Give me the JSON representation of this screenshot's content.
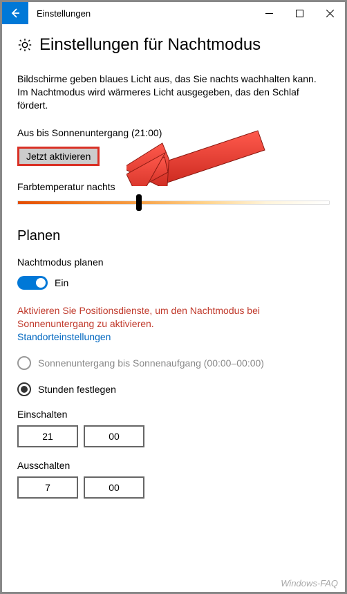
{
  "window": {
    "app_title": "Einstellungen"
  },
  "page": {
    "title": "Einstellungen für Nachtmodus",
    "description": "Bildschirme geben blaues Licht aus, das Sie nachts wachhalten kann. Im Nachtmodus wird wärmeres Licht ausgegeben, das den Schlaf fördert.",
    "status_line": "Aus bis Sonnenuntergang (21:00)",
    "activate_button": "Jetzt aktivieren",
    "color_temp_label": "Farbtemperatur nachts",
    "color_temp_value_percent": 38
  },
  "schedule": {
    "heading": "Planen",
    "toggle_label": "Nachtmodus planen",
    "toggle_state": "Ein",
    "warning": "Aktivieren Sie Positionsdienste, um den Nachtmodus bei Sonnenuntergang zu aktivieren.",
    "link": "Standorteinstellungen",
    "radio_sunset": "Sonnenuntergang bis Sonnenaufgang (00:00–00:00)",
    "radio_hours": "Stunden festlegen",
    "turn_on_label": "Einschalten",
    "turn_on_hour": "21",
    "turn_on_minute": "00",
    "turn_off_label": "Ausschalten",
    "turn_off_hour": "7",
    "turn_off_minute": "00"
  },
  "watermark": "Windows-FAQ"
}
